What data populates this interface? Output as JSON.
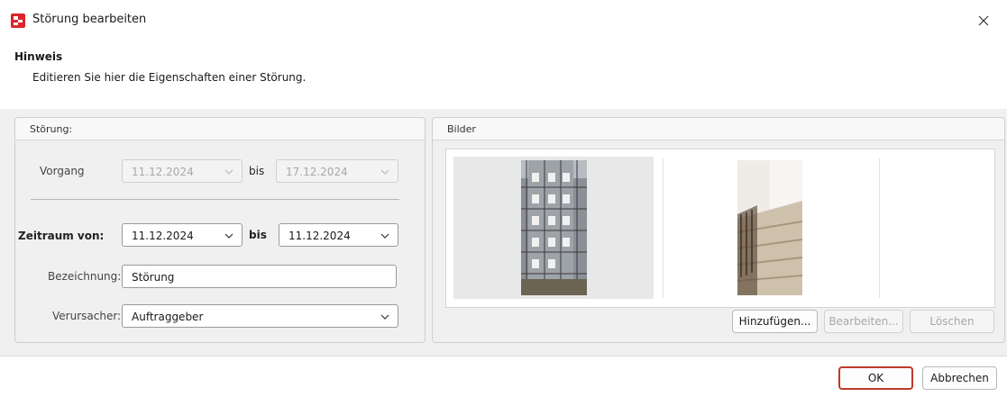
{
  "window": {
    "title": "Störung bearbeiten",
    "icon": "app-logo-icon",
    "accent_color": "#c0392b"
  },
  "hint": {
    "title": "Hinweis",
    "text": "Editieren Sie hier die Eigenschaften einer Störung."
  },
  "stoerung": {
    "group_label": "Störung:",
    "vorgang": {
      "label": "Vorgang",
      "from": "11.12.2024",
      "to_label": "bis",
      "to": "17.12.2024"
    },
    "zeitraum": {
      "label": "Zeitraum von:",
      "from": "11.12.2024",
      "to_label": "bis",
      "to": "11.12.2024"
    },
    "bezeichnung": {
      "label": "Bezeichnung:",
      "value": "Störung"
    },
    "verursacher": {
      "label": "Verursacher:",
      "value": "Auftraggeber"
    }
  },
  "bilder": {
    "group_label": "Bilder",
    "images": [
      {
        "name": "scaffolding-facade-photo"
      },
      {
        "name": "staircase-photo"
      }
    ],
    "buttons": {
      "add": "Hinzufügen...",
      "edit": "Bearbeiten...",
      "delete": "Löschen"
    }
  },
  "footer": {
    "ok": "OK",
    "cancel": "Abbrechen"
  }
}
